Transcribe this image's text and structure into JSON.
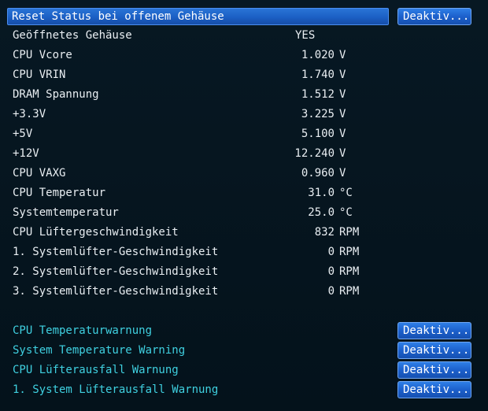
{
  "header": {
    "selected_label": "Reset Status bei offenem Gehäuse",
    "selected_value": "Deaktiv..."
  },
  "status": {
    "chassis_open_label": "Geöffnetes Gehäuse",
    "chassis_open_value": "YES"
  },
  "readings": [
    {
      "label": "CPU Vcore",
      "value": "1.020",
      "unit": "V"
    },
    {
      "label": "CPU VRIN",
      "value": "1.740",
      "unit": "V"
    },
    {
      "label": "DRAM Spannung",
      "value": "1.512",
      "unit": "V"
    },
    {
      "label": "+3.3V",
      "value": "3.225",
      "unit": "V"
    },
    {
      "label": "+5V",
      "value": "5.100",
      "unit": "V"
    },
    {
      "label": "+12V",
      "value": "12.240",
      "unit": "V"
    },
    {
      "label": "CPU VAXG",
      "value": "0.960",
      "unit": "V"
    },
    {
      "label": "CPU Temperatur",
      "value": "31.0",
      "unit": "°C"
    },
    {
      "label": "Systemtemperatur",
      "value": "25.0",
      "unit": "°C"
    },
    {
      "label": "CPU Lüftergeschwindigkeit",
      "value": "832",
      "unit": "RPM"
    },
    {
      "label": "1. Systemlüfter-Geschwindigkeit",
      "value": "0",
      "unit": "RPM"
    },
    {
      "label": "2. Systemlüfter-Geschwindigkeit",
      "value": "0",
      "unit": "RPM"
    },
    {
      "label": "3. Systemlüfter-Geschwindigkeit",
      "value": "0",
      "unit": "RPM"
    }
  ],
  "warnings": [
    {
      "label": "CPU Temperaturwarnung",
      "value": "Deaktiv..."
    },
    {
      "label": "System Temperature Warning",
      "value": "Deaktiv..."
    },
    {
      "label": "CPU Lüfterausfall Warnung",
      "value": "Deaktiv..."
    },
    {
      "label": "1. System Lüfterausfall Warnung",
      "value": "Deaktiv..."
    }
  ],
  "colors": {
    "background": "#05111a",
    "accent_blue": "#1c60cc",
    "warning_text": "#3fd0e0",
    "text": "#e9eef2"
  }
}
